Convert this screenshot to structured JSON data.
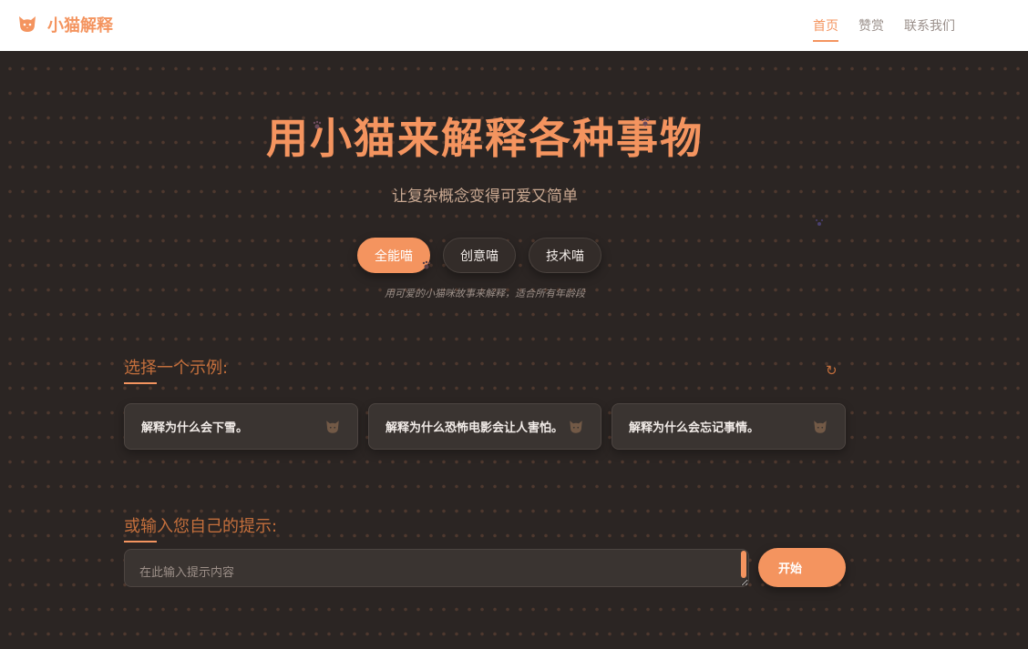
{
  "nav": {
    "brand_name": "小猫解释",
    "links": [
      {
        "label": "首页",
        "active": true
      },
      {
        "label": "赞赏",
        "active": false
      },
      {
        "label": "联系我们",
        "active": false
      }
    ]
  },
  "hero": {
    "title": "用小猫来解释各种事物",
    "subtitle": "让复杂概念变得可爱又简单"
  },
  "modes": {
    "items": [
      {
        "label": "全能喵",
        "active": true
      },
      {
        "label": "创意喵",
        "active": false
      },
      {
        "label": "技术喵",
        "active": false
      }
    ],
    "description": "用可爱的小猫咪故事来解释，适合所有年龄段"
  },
  "examples": {
    "title": "选择一个示例:",
    "refresh_icon": "refresh-icon",
    "items": [
      {
        "label": "解释为什么会下雪。"
      },
      {
        "label": "解释为什么恐怖电影会让人害怕。"
      },
      {
        "label": "解释为什么会忘记事情。"
      }
    ]
  },
  "prompt": {
    "title": "或输入您自己的提示:",
    "placeholder": "在此输入提示内容",
    "value": "",
    "submit_label": "开始"
  },
  "colors": {
    "accent": "#f4945f",
    "background": "#2b2523",
    "card": "#3a3431"
  }
}
